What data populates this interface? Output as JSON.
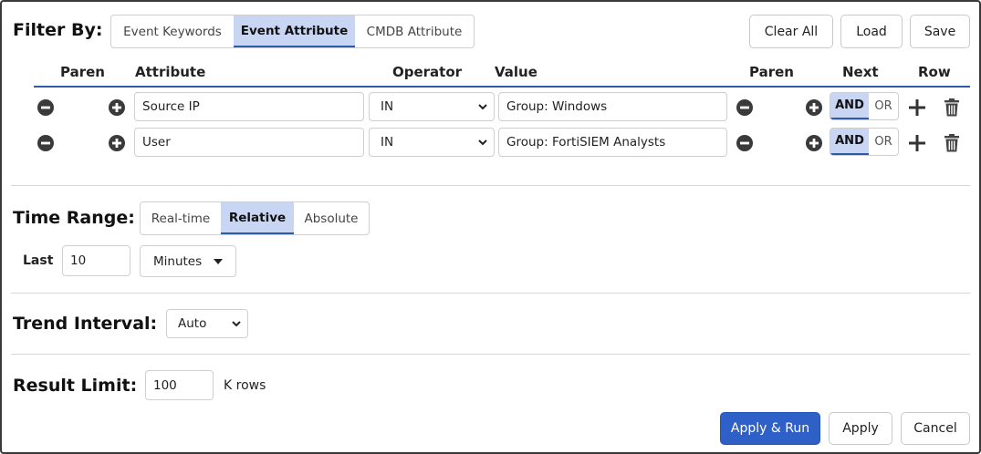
{
  "filter": {
    "label": "Filter By:",
    "tabs": [
      "Event Keywords",
      "Event Attribute",
      "CMDB Attribute"
    ],
    "active_tab": "Event Attribute",
    "buttons": {
      "clear_all": "Clear All",
      "load": "Load",
      "save": "Save"
    },
    "columns": {
      "paren_left": "Paren",
      "attribute": "Attribute",
      "operator": "Operator",
      "value": "Value",
      "paren_right": "Paren",
      "next": "Next",
      "row": "Row"
    },
    "rows": [
      {
        "attribute": "Source IP",
        "operator": "IN",
        "value": "Group: Windows",
        "next_and": "AND",
        "next_or": "OR",
        "next_selected": "AND"
      },
      {
        "attribute": "User",
        "operator": "IN",
        "value": "Group: FortiSIEM Analysts",
        "next_and": "AND",
        "next_or": "OR",
        "next_selected": "AND"
      }
    ]
  },
  "time_range": {
    "label": "Time Range:",
    "tabs": [
      "Real-time",
      "Relative",
      "Absolute"
    ],
    "active_tab": "Relative",
    "last_label": "Last",
    "last_value": "10",
    "unit": "Minutes"
  },
  "trend_interval": {
    "label": "Trend Interval:",
    "value": "Auto"
  },
  "result_limit": {
    "label": "Result Limit:",
    "value": "100",
    "unit": "K rows"
  },
  "footer": {
    "apply_run": "Apply & Run",
    "apply": "Apply",
    "cancel": "Cancel"
  },
  "colors": {
    "accent": "#2f60c7",
    "active_tab_bg": "#c9d6f3",
    "underline": "#2f5aa8"
  }
}
